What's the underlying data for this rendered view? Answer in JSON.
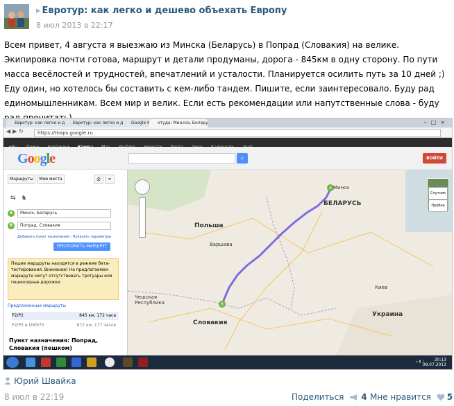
{
  "post": {
    "title": "Евротур: как легко и дешево объехать Европу",
    "date": "8 июл 2013 в 22:17",
    "text": "Всем привет, 4 августа я выезжаю из Минска (Беларусь) в Попрад (Словакия) на велике. Экипировка почти готова, маршрут и детали продуманы, дорога - 845км в одну сторону. По пути масса весёлостей и трудностей, впечатлений и усталости. Планируется осилить путь за 10 дней ;) Еду один, но хотелось бы составить с кем-либо тандем. Пишите, если заинтересовало. Буду рад единомышленникам. Всем мир и велик. Если есть рекомендации или напутственные слова - буду рад прочитать)",
    "author": "Юрий Швайка",
    "footer_date": "8 июл в 22:19",
    "share_label": "Поделиться",
    "share_count": "4",
    "like_label": "Мне нравится",
    "like_count": "5"
  },
  "screenshot": {
    "tabs": [
      "Евротур: как легко и дешево об...",
      "Евротур: как легко и дешево об...",
      "Google Карты",
      "отуда: Минска, Беларусь"
    ],
    "url": "https://maps.google.ru",
    "gbar": [
      "+Вы",
      "Поиск",
      "Картинки",
      "Карты",
      "Play",
      "YouTube",
      "Новости",
      "Почта",
      "Диск",
      "Календарь",
      "Ещё"
    ],
    "logo": "Google",
    "signin": "ВОЙТИ",
    "panel": {
      "btn_routes": "Маршруты",
      "btn_places": "Мои места",
      "from": "Минск, Беларусь",
      "to": "Попрад, Словакия",
      "add_point": "Добавить пункт назначения - Показать параметры",
      "get_dir": "ПРОЛОЖИТЬ МАРШРУТ",
      "beta": "Пешие маршруты находятся в режиме бета-тестирования. Внимание! На предлагаемом маршруте могут отсутствовать тротуары или пешеходные дорожки",
      "suggested": "Предложенные маршруты",
      "routes": [
        {
          "name": "P2/P2",
          "value": "845 км, 172 часа"
        },
        {
          "name": "P2/P2 и DW975",
          "value": "872 км, 177 часов"
        }
      ],
      "destination": "Пункт назначения: Попрад, Словакия (пешком)"
    },
    "map": {
      "labels": {
        "belarus": "БЕЛАРУСЬ",
        "poland": "Польша",
        "ukraine": "Украина",
        "czech": "Чешская Республика",
        "slovakia": "Словакия",
        "minsk": "Минск",
        "warsaw": "Варшава",
        "kiev": "Киев"
      },
      "map_btn": "Спутник",
      "traffic_btn": "Пробки"
    },
    "clock_time": "20:13",
    "clock_date": "08.07.2013"
  }
}
